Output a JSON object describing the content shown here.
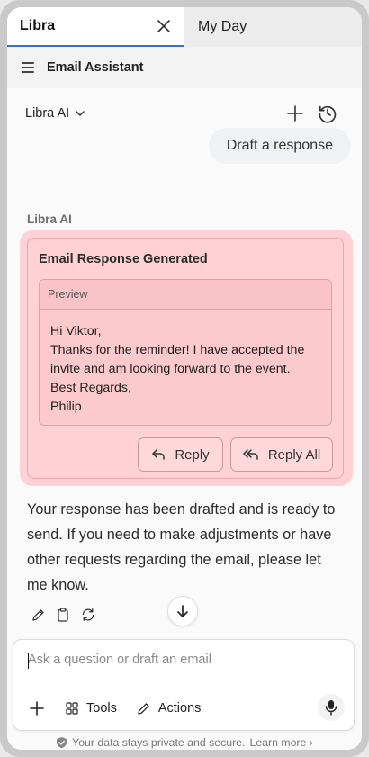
{
  "tabs": [
    {
      "label": "Libra",
      "active": true
    },
    {
      "label": "My Day",
      "active": false
    }
  ],
  "header": {
    "title": "Email Assistant"
  },
  "model_select": {
    "label": "Libra AI"
  },
  "user_message": "Draft a response",
  "assistant": {
    "name": "Libra AI",
    "card_title": "Email Response Generated",
    "preview_label": "Preview",
    "preview_lines": [
      "Hi Viktor,",
      "Thanks for the reminder! I have accepted the",
      "invite and am looking forward to the event.",
      "Best Regards,",
      "Philip"
    ],
    "reply_label": "Reply",
    "reply_all_label": "Reply All",
    "response_text": "Your response has been drafted and is ready to send. If you need to make adjustments or have other requests regarding the email, please let me know."
  },
  "composer": {
    "placeholder": "Ask a question or draft an email",
    "tools_label": "Tools",
    "actions_label": "Actions"
  },
  "footer": {
    "text": "Your data stays private and secure.",
    "link": "Learn more"
  },
  "colors": {
    "highlight": "#ffd1d4",
    "tab_underline": "#2f6fd6"
  }
}
